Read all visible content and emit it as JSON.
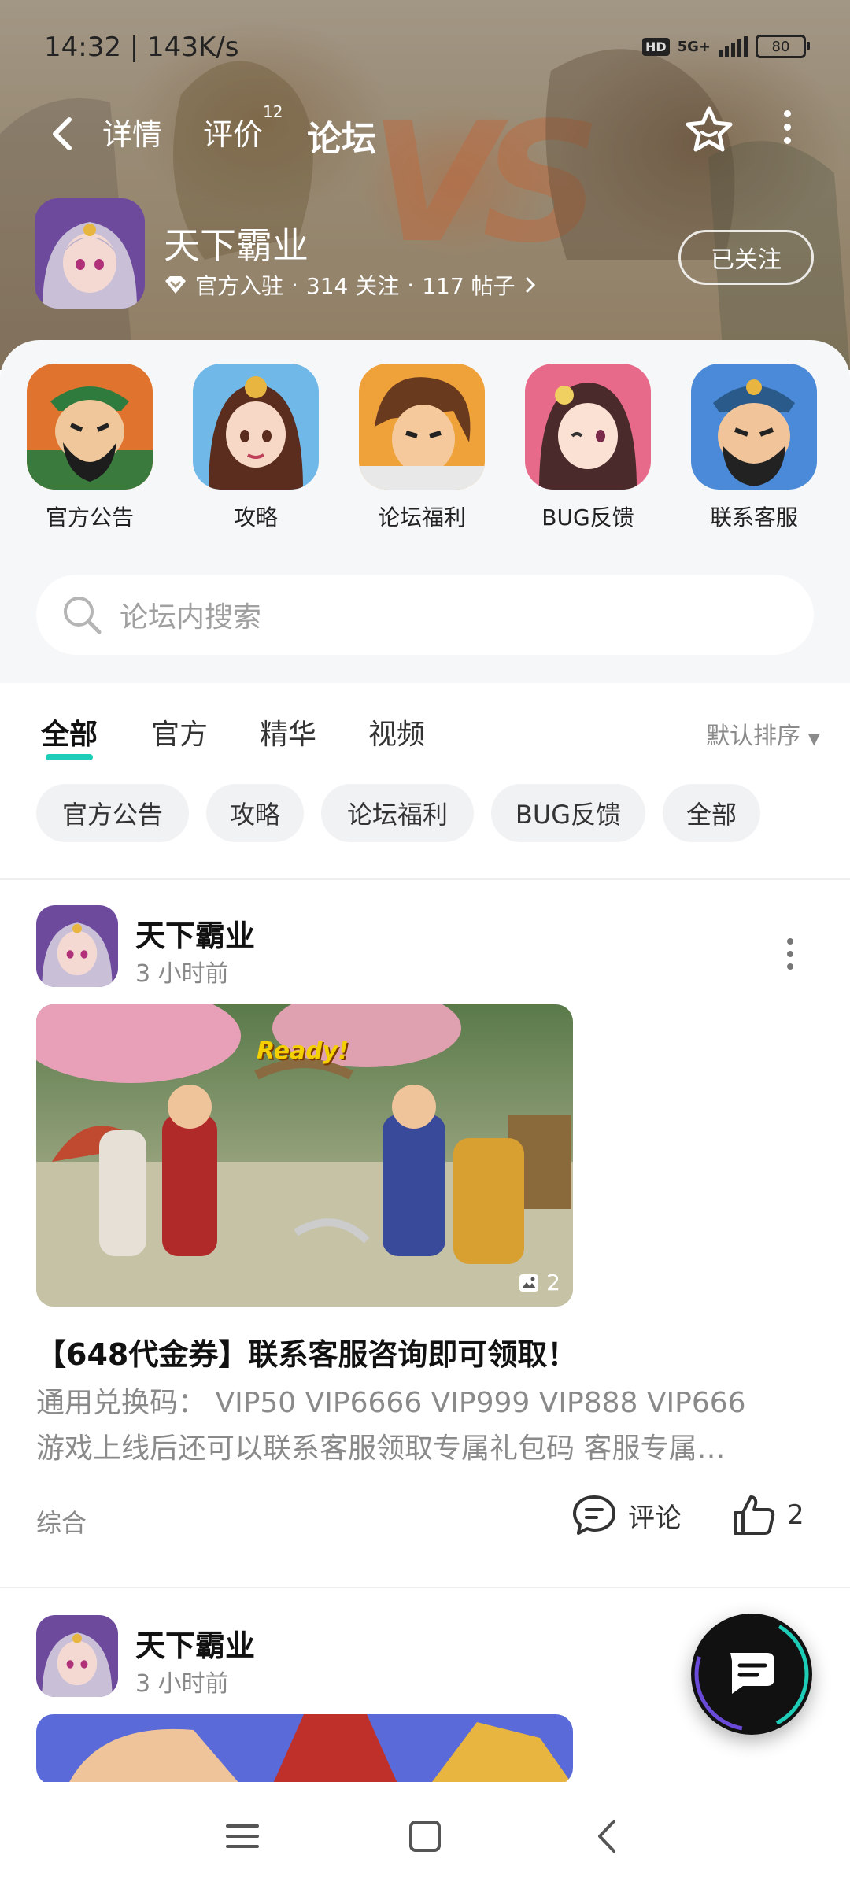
{
  "status_bar": {
    "time": "14:32 | 143K/s",
    "network_label": "HD",
    "signal_label": "5G+",
    "battery": "80"
  },
  "nav": {
    "tabs": [
      {
        "label": "详情"
      },
      {
        "label": "评价",
        "badge": "12"
      },
      {
        "label": "论坛"
      }
    ],
    "active_tab": "论坛"
  },
  "game": {
    "name": "天下霸业",
    "badge": "官方入驻",
    "followers": "314 关注",
    "posts": "117 帖子",
    "follow_button": "已关注"
  },
  "shortcuts": [
    {
      "label": "官方公告",
      "icon": "guan-yu-portrait-icon"
    },
    {
      "label": "攻略",
      "icon": "heroine-portrait-icon"
    },
    {
      "label": "论坛福利",
      "icon": "warrior-portrait-icon"
    },
    {
      "label": "BUG反馈",
      "icon": "maiden-portrait-icon"
    },
    {
      "label": "联系客服",
      "icon": "general-portrait-icon"
    }
  ],
  "search": {
    "placeholder": "论坛内搜索"
  },
  "filter_tabs": [
    "全部",
    "官方",
    "精华",
    "视频"
  ],
  "sort_label": "默认排序",
  "chips": [
    "官方公告",
    "攻略",
    "论坛福利",
    "BUG反馈",
    "全部"
  ],
  "posts": [
    {
      "author": "天下霸业",
      "time": "3 小时前",
      "image_count": "2",
      "image_caption": "Ready!",
      "title": "【648代金券】联系客服咨询即可领取！",
      "body_line1": "通用兑换码： VIP50 VIP6666 VIP999 VIP888 VIP666",
      "body_line2": "游戏上线后还可以联系客服领取专属礼包码 客服专属…",
      "tag": "综合",
      "comment_label": "评论",
      "likes": "2"
    },
    {
      "author": "天下霸业",
      "time": "3 小时前"
    }
  ],
  "colors": {
    "accent": "#1ecdb8"
  }
}
